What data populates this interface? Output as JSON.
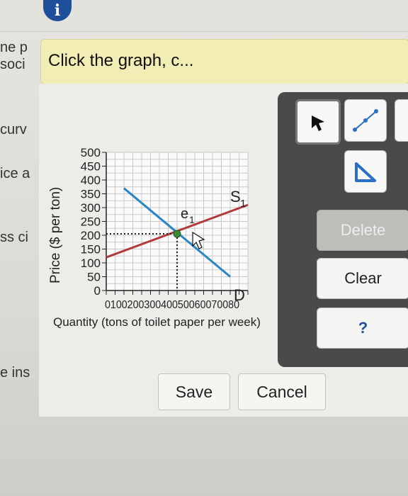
{
  "info_icon": {
    "glyph": "i",
    "icon": "info-icon"
  },
  "left_snippets": [
    "ne p",
    "soci",
    "curv",
    "ice a",
    "ss ci",
    "e ins"
  ],
  "hint": {
    "text": "Click the graph, c..."
  },
  "graph": {
    "ylabel": "Price ($ per ton)",
    "xlabel": "Quantity (tons of toilet paper per week)",
    "y_ticks": [
      "0",
      "50",
      "100",
      "150",
      "200",
      "250",
      "300",
      "350",
      "400",
      "450",
      "500"
    ],
    "x_ticks_text": "010020030040050060070080",
    "x_end_label": "D",
    "supply_label": "S",
    "supply_sub": "1",
    "eq_label": "e",
    "eq_sub": "1",
    "colors": {
      "supply": "#b03a3a",
      "demand": "#2a84c6",
      "equilibrium": "#3a8a3a",
      "grid": "#c9c9c9"
    }
  },
  "chart_data": {
    "type": "line",
    "title": "",
    "xlabel": "Quantity (tons of toilet paper per week)",
    "ylabel": "Price ($ per ton)",
    "xlim": [
      0,
      800
    ],
    "ylim": [
      0,
      500
    ],
    "series": [
      {
        "name": "S1",
        "points": [
          [
            0,
            120
          ],
          [
            800,
            310
          ]
        ]
      },
      {
        "name": "",
        "points": [
          [
            100,
            370
          ],
          [
            700,
            50
          ]
        ]
      }
    ],
    "equilibrium": {
      "name": "e1",
      "x": 400,
      "y": 205
    }
  },
  "tools": [
    {
      "name": "pointer-tool",
      "icon": "arrow-cursor-icon"
    },
    {
      "name": "line-tool",
      "icon": "line-draw-icon"
    },
    {
      "name": "triangle-tool",
      "icon": "triangle-icon"
    }
  ],
  "buttons": {
    "delete": "Delete",
    "clear": "Clear",
    "help": "?",
    "save": "Save",
    "cancel": "Cancel"
  }
}
